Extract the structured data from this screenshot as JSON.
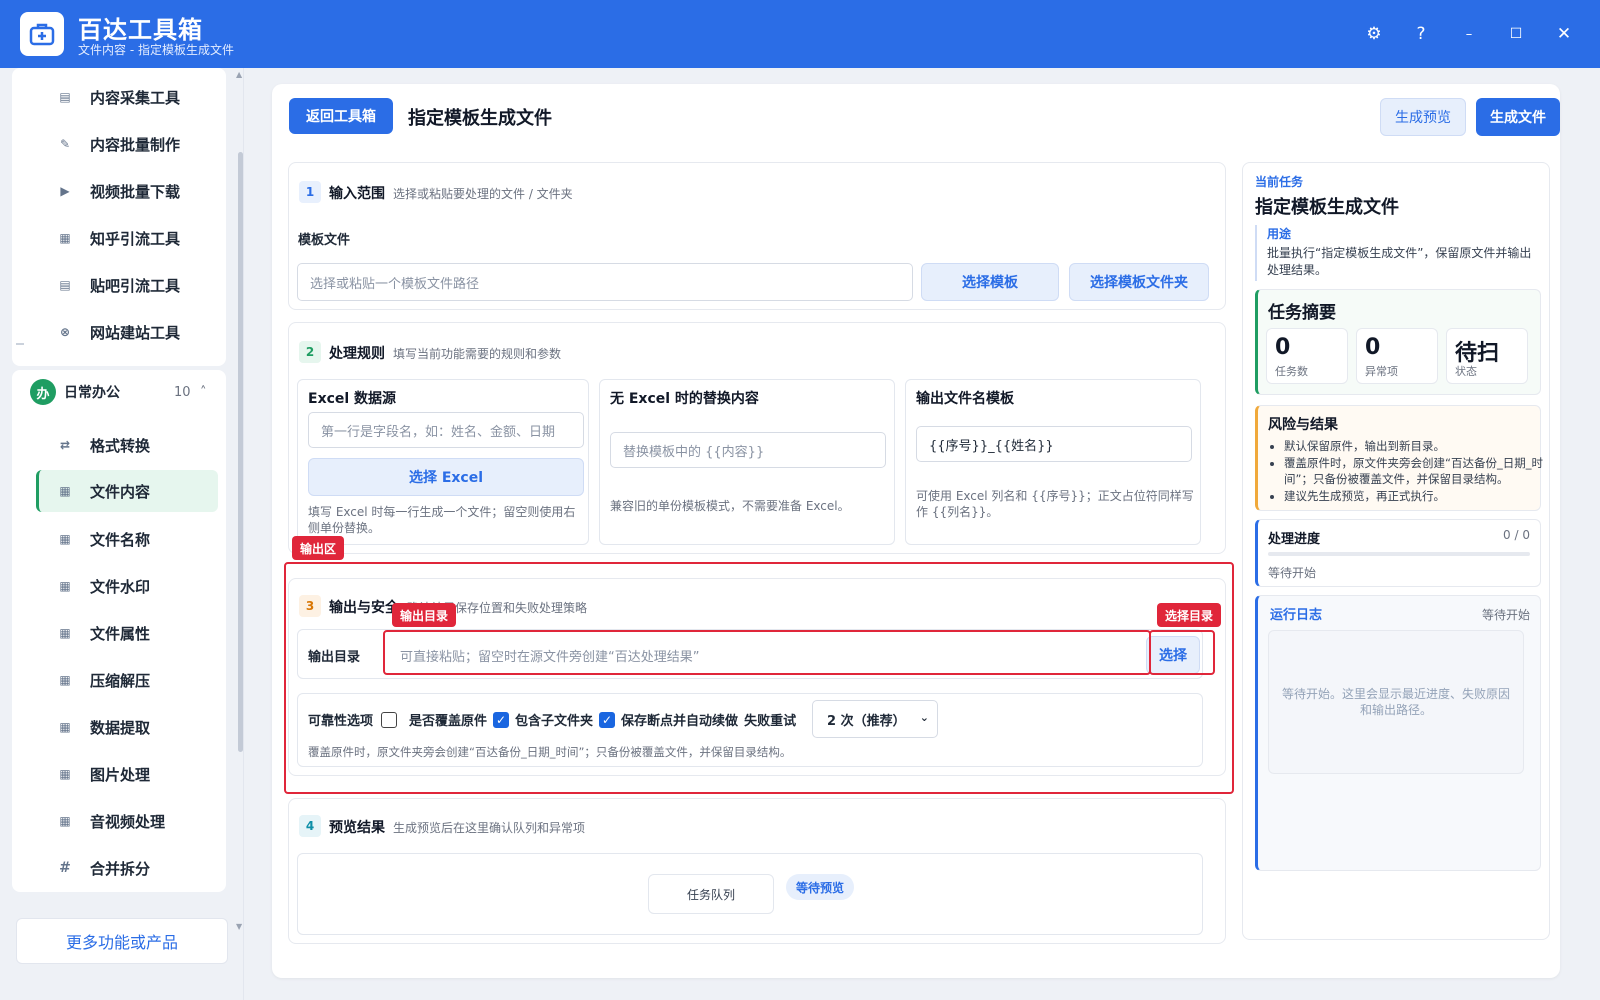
{
  "app": {
    "title": "百达工具箱",
    "subtitle": "文件内容 - 指定模板生成文件"
  },
  "window_controls": {
    "settings": "⚙",
    "help": "?",
    "minimize": "–",
    "maximize": "☐",
    "close": "✕"
  },
  "sidebar": {
    "top_items": [
      {
        "label": "内容采集工具",
        "icon": "▤"
      },
      {
        "label": "内容批量制作",
        "icon": "✎"
      },
      {
        "label": "视频批量下载",
        "icon": "▶"
      },
      {
        "label": "知乎引流工具",
        "icon": "▦"
      },
      {
        "label": "贴吧引流工具",
        "icon": "▤"
      },
      {
        "label": "网站建站工具",
        "icon": "⊗"
      }
    ],
    "group": {
      "badge": "办",
      "name": "日常办公",
      "count": "10",
      "chevron": "˄"
    },
    "group_items": [
      {
        "label": "格式转换",
        "icon": "⇄"
      },
      {
        "label": "文件内容",
        "icon": "▦"
      },
      {
        "label": "文件名称",
        "icon": "▦"
      },
      {
        "label": "文件水印",
        "icon": "▦"
      },
      {
        "label": "文件属性",
        "icon": "▦"
      },
      {
        "label": "压缩解压",
        "icon": "▦"
      },
      {
        "label": "数据提取",
        "icon": "▦"
      },
      {
        "label": "图片处理",
        "icon": "▦"
      },
      {
        "label": "音视频处理",
        "icon": "▦"
      },
      {
        "label": "合并拆分",
        "icon": "#"
      }
    ],
    "more_button": "更多功能或产品"
  },
  "header": {
    "back_button": "返回工具箱",
    "page_title": "指定模板生成文件",
    "preview_button": "生成预览",
    "generate_button": "生成文件"
  },
  "step1": {
    "num": "1",
    "title": "输入范围",
    "desc": "选择或粘贴要处理的文件 / 文件夹",
    "field_label": "模板文件",
    "input_placeholder": "选择或粘贴一个模板文件路径",
    "select_template": "选择模板",
    "select_template_folder": "选择模板文件夹"
  },
  "step2": {
    "num": "2",
    "title": "处理规则",
    "desc": "填写当前功能需要的规则和参数",
    "excel": {
      "title": "Excel 数据源",
      "placeholder": "第一行是字段名，如：姓名、金额、日期",
      "button": "选择 Excel",
      "hint": "填写 Excel 时每一行生成一个文件；留空则使用右侧单份替换。"
    },
    "no_excel": {
      "title": "无 Excel 时的替换内容",
      "placeholder": "替换模板中的 {{内容}}",
      "hint": "兼容旧的单份模板模式，不需要准备 Excel。"
    },
    "filename": {
      "title": "输出文件名模板",
      "value": "{{序号}}_{{姓名}}",
      "hint": "可使用 Excel 列名和 {{序号}}；正文占位符同样写作 {{列名}}。"
    }
  },
  "annotations": {
    "output_area": "输出区",
    "output_dir": "输出目录",
    "select_dir": "选择目录"
  },
  "step3": {
    "num": "3",
    "title": "输出与安全",
    "desc": "确认结果保存位置和失败处理策略",
    "dir_label": "输出目录",
    "dir_placeholder": "可直接粘贴；留空时在源文件旁创建“百达处理结果”",
    "choose_button": "选择",
    "reliability_label": "可靠性选项",
    "overwrite_label": "是否覆盖原件",
    "overwrite_checked": false,
    "subfolders_label": "包含子文件夹",
    "subfolders_checked": true,
    "resume_label": "保存断点并自动续做",
    "resume_checked": true,
    "retry_label": "失败重试",
    "retry_value": "2 次（推荐）",
    "note": "覆盖原件时，原文件夹旁会创建“百达备份_日期_时间”；只备份被覆盖文件，并保留目录结构。"
  },
  "step4": {
    "num": "4",
    "title": "预览结果",
    "desc": "生成预览后在这里确认队列和异常项",
    "queue_tab": "任务队列",
    "status_badge": "等待预览"
  },
  "right_panel": {
    "current_task_label": "当前任务",
    "task_title": "指定模板生成文件",
    "usage_label": "用途",
    "usage_text": "批量执行“指定模板生成文件”，保留原文件并输出处理结果。",
    "summary_title": "任务摘要",
    "stats": [
      {
        "value": "0",
        "label": "任务数"
      },
      {
        "value": "0",
        "label": "异常项"
      },
      {
        "value": "待扫",
        "label": "状态"
      }
    ],
    "risk_title": "风险与结果",
    "risk_items": [
      "默认保留原件，输出到新目录。",
      "覆盖原件时，原文件夹旁会创建“百达备份_日期_时间”；只备份被覆盖文件，并保留目录结构。",
      "建议先生成预览，再正式执行。"
    ],
    "progress_title": "处理进度",
    "progress_count": "0 / 0",
    "progress_fraction": 0,
    "progress_status": "等待开始",
    "log_title": "运行日志",
    "log_status": "等待开始",
    "log_placeholder": "等待开始。这里会显示最近进度、失败原因和输出路径。"
  },
  "colors": {
    "brand": "#2b6de6",
    "active_green": "#1f9d62",
    "annotation_red": "#e0263a",
    "risk_orange": "#f0a93b"
  }
}
